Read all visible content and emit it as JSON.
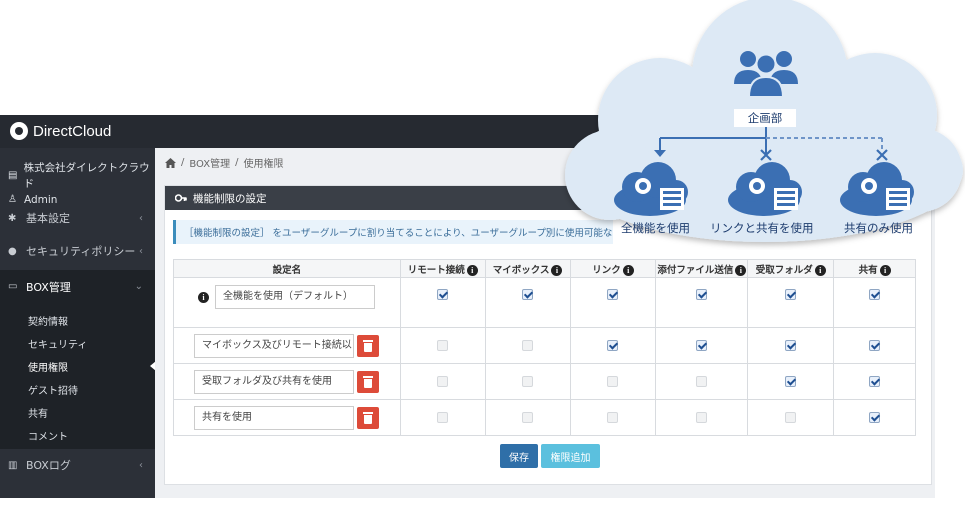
{
  "app": {
    "logo_text": "DirectCloud"
  },
  "sidebar": {
    "company": "株式会社ダイレクトクラウド",
    "user": "Admin",
    "items": [
      {
        "label": "基本設定",
        "icon": "gear-icon"
      },
      {
        "label": "セキュリティポリシー",
        "icon": "lock-icon"
      },
      {
        "label": "BOX管理",
        "icon": "box-icon"
      },
      {
        "label": "BOXログ",
        "icon": "chart-icon"
      }
    ],
    "submenu": [
      "契約情報",
      "セキュリティ",
      "使用権限",
      "ゲスト招待",
      "共有",
      "コメント"
    ]
  },
  "breadcrumb": {
    "home_icon": "home-icon",
    "parts": [
      "BOX管理",
      "使用権限"
    ]
  },
  "panel": {
    "title": "機能制限の設定",
    "notice": "［機能制限の設定］ をユーザーグループに割り当てることにより、ユーザーグループ別に使用可能な"
  },
  "table": {
    "headers": [
      "設定名",
      "リモート接続",
      "マイボックス",
      "リンク",
      "添付ファイル送信",
      "受取フォルダ",
      "共有"
    ],
    "rows": [
      {
        "name": "全機能を使用（デフォルト）",
        "checks": [
          true,
          true,
          true,
          true,
          true,
          true
        ],
        "deletable": false
      },
      {
        "name": "マイボックス及びリモート接続以",
        "checks": [
          false,
          false,
          true,
          true,
          true,
          true
        ],
        "deletable": true
      },
      {
        "name": "受取フォルダ及び共有を使用",
        "checks": [
          false,
          false,
          false,
          false,
          true,
          true
        ],
        "deletable": true
      },
      {
        "name": "共有を使用",
        "checks": [
          false,
          false,
          false,
          false,
          false,
          true
        ],
        "deletable": true
      }
    ]
  },
  "buttons": {
    "save": "保存",
    "add": "権限追加"
  },
  "cloud": {
    "group": "企画部",
    "options": [
      "全機能を使用",
      "リンクと共有を使用",
      "共有のみ使用"
    ],
    "color": "#3b6fb3"
  }
}
